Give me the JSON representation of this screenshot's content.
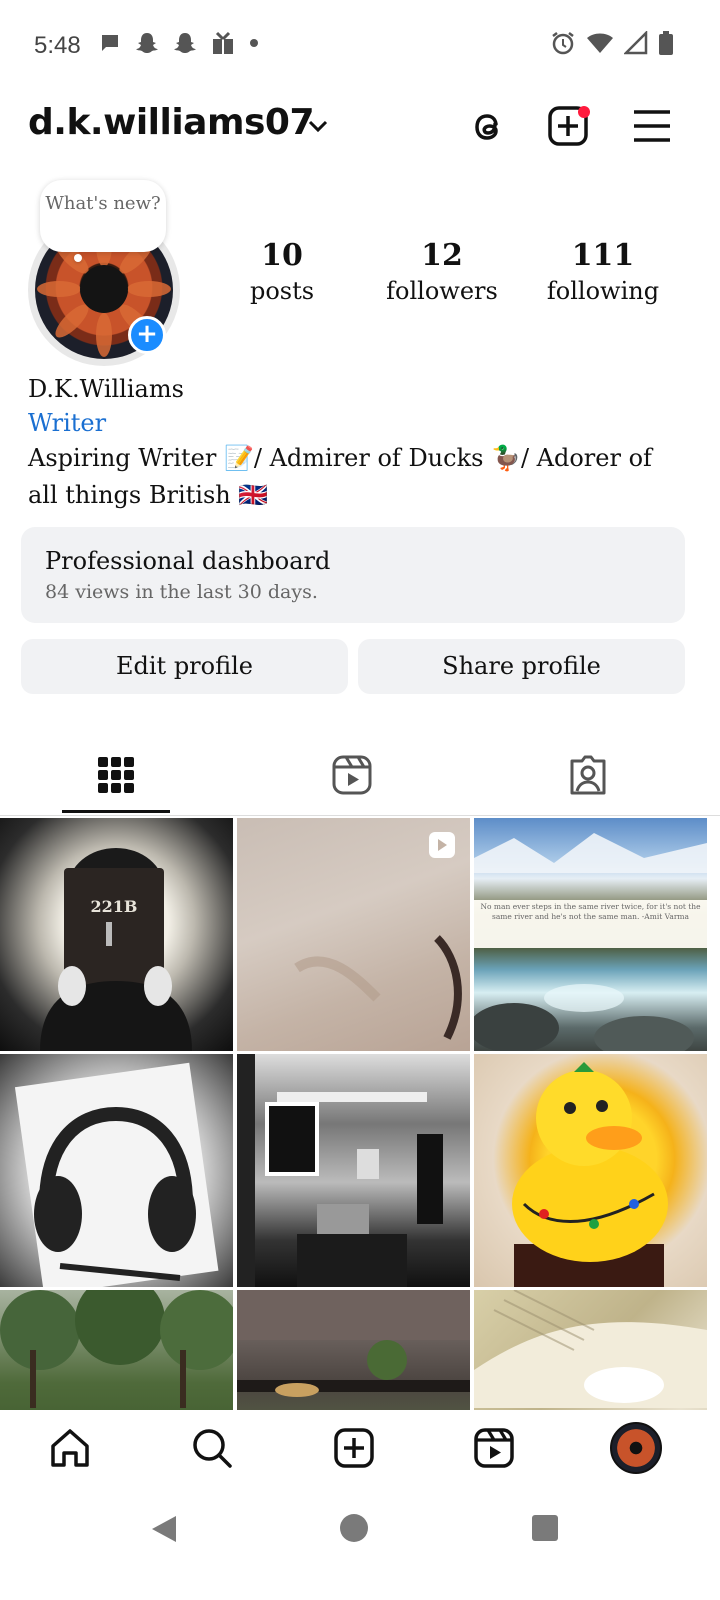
{
  "status_bar": {
    "time": "5:48",
    "left_icons": [
      "message-icon",
      "snapchat-icon",
      "snapchat-icon",
      "gift-icon",
      "dot-icon"
    ],
    "right_icons": [
      "alarm-icon",
      "wifi-icon",
      "signal-icon",
      "battery-icon"
    ]
  },
  "header": {
    "username": "d.k.williams07",
    "icons": [
      "chevron-down-icon",
      "threads-icon",
      "create-icon",
      "menu-icon"
    ]
  },
  "profile": {
    "note": "What's new?",
    "add_story_icon": "plus-icon",
    "stats": [
      {
        "value": "10",
        "label": "posts"
      },
      {
        "value": "12",
        "label": "followers"
      },
      {
        "value": "111",
        "label": "following"
      }
    ],
    "name": "D.K.Williams",
    "category": "Writer",
    "bio": "Aspiring Writer 📝/ Admirer of Ducks 🦆/ Adorer of all things British 🇬🇧"
  },
  "dashboard": {
    "title": "Professional dashboard",
    "subtitle": "84 views in the last 30 days."
  },
  "buttons": {
    "edit": "Edit profile",
    "share": "Share profile"
  },
  "tabs": {
    "icons": [
      "grid-icon",
      "reels-icon",
      "tagged-icon"
    ],
    "active": "grid"
  },
  "grid": {
    "posts": [
      {
        "label": "221B"
      },
      {
        "label": ""
      },
      {
        "label": "No man ever steps in the same river twice, for it's not the same river and he's not the same man. -Amit Varma"
      },
      {
        "label": ""
      },
      {
        "label": ""
      },
      {
        "label": ""
      },
      {
        "label": ""
      },
      {
        "label": ""
      },
      {
        "label": ""
      }
    ]
  },
  "bottom_nav": {
    "items": [
      "home-icon",
      "search-icon",
      "create-icon",
      "reels-icon",
      "profile-avatar"
    ]
  },
  "system_nav": {
    "items": [
      "back-icon",
      "home-icon",
      "recents-icon"
    ]
  }
}
